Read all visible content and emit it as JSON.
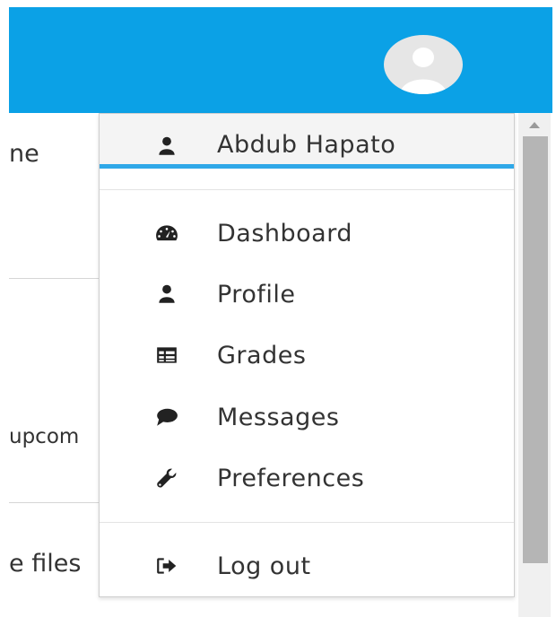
{
  "navbar": {
    "color": "#0ba1e6",
    "avatar_icon": "user-avatar-icon"
  },
  "background_page": {
    "fragments": [
      "ne",
      "upcom",
      "e files"
    ]
  },
  "user_menu": {
    "user_name": "Abdub Hapato",
    "user_icon": "user-icon",
    "accent_color": "#2fa8e8",
    "items": [
      {
        "label": "Dashboard",
        "icon": "dashboard-gauge-icon"
      },
      {
        "label": "Profile",
        "icon": "user-icon"
      },
      {
        "label": "Grades",
        "icon": "table-icon"
      },
      {
        "label": "Messages",
        "icon": "speech-bubble-icon"
      },
      {
        "label": "Preferences",
        "icon": "wrench-icon"
      }
    ],
    "logout": {
      "label": "Log out",
      "icon": "sign-out-icon"
    }
  }
}
